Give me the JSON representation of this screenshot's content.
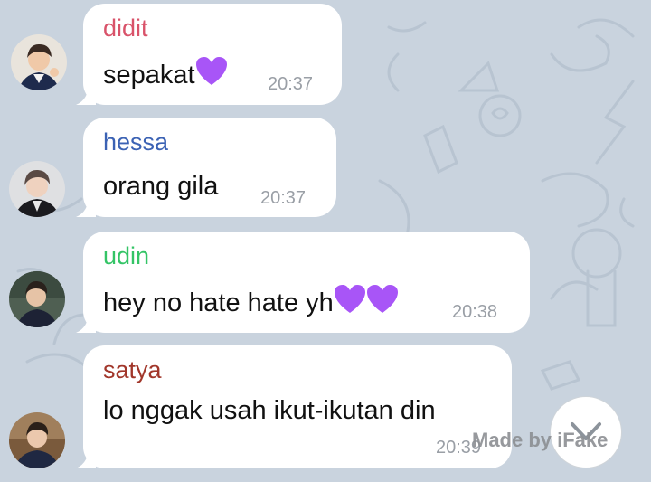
{
  "messages": [
    {
      "sender": "didit",
      "sender_color": "#d9536a",
      "text": "sepakat",
      "emoji": "purple-heart",
      "time": "20:37"
    },
    {
      "sender": "hessa",
      "sender_color": "#3b62b4",
      "text": "orang gila",
      "time": "20:37"
    },
    {
      "sender": "udin",
      "sender_color": "#34c466",
      "text": "hey no hate hate yh",
      "emoji": "purple-heart",
      "time": "20:38"
    },
    {
      "sender": "satya",
      "sender_color": "#a1362a",
      "text": "lo nggak usah ikut-ikutan din",
      "time": "20:39"
    }
  ],
  "watermark": "Made by iFake",
  "colors": {
    "background": "#c9d3de",
    "bubble": "#ffffff",
    "timestamp": "#9a9fa6",
    "heart": "#a855f7"
  }
}
